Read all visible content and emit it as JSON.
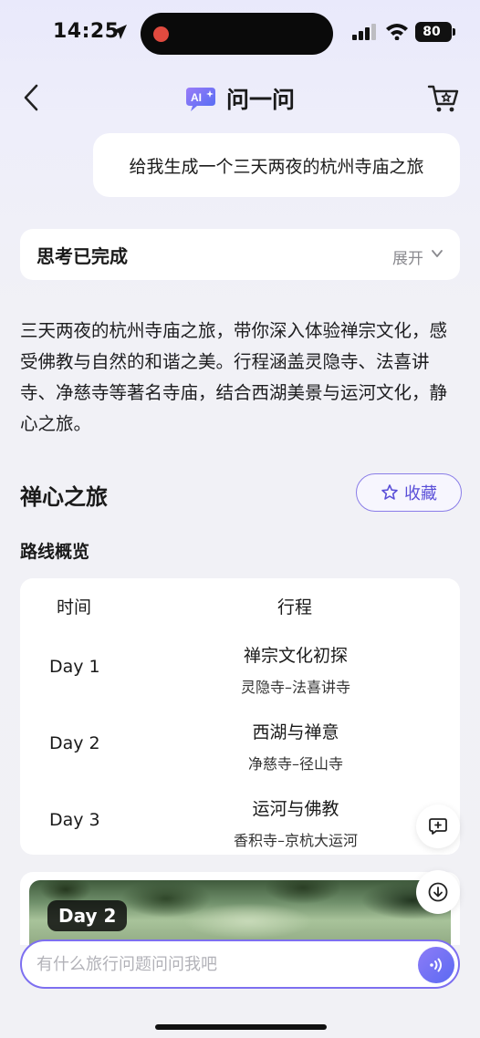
{
  "status_bar": {
    "time": "14:25",
    "battery": "80"
  },
  "nav": {
    "title": "问一问",
    "logo_text": "AI"
  },
  "user_message": "给我生成一个三天两夜的杭州寺庙之旅",
  "thinking": {
    "label": "思考已完成",
    "expand": "展开"
  },
  "intro": "三天两夜的杭州寺庙之旅，带你深入体验禅宗文化，感受佛教与自然的和谐之美。行程涵盖灵隐寺、法喜讲寺、净慈寺等著名寺庙，结合西湖美景与运河文化，静心之旅。",
  "itinerary": {
    "title": "禅心之旅",
    "favorite_label": "收藏",
    "overview_title": "路线概览",
    "columns": [
      "时间",
      "行程"
    ],
    "rows": [
      {
        "day": "Day 1",
        "title": "禅宗文化初探",
        "route": "灵隐寺–法喜讲寺"
      },
      {
        "day": "Day 2",
        "title": "西湖与禅意",
        "route": "净慈寺–径山寺"
      },
      {
        "day": "Day 3",
        "title": "运河与佛教",
        "route": "香积寺–京杭大运河"
      }
    ],
    "image_badge": "Day 2"
  },
  "input": {
    "placeholder": "有什么旅行问题问问我吧",
    "value": ""
  },
  "colors": {
    "accent": "#7d6ff0",
    "accent_text": "#5a4fd8",
    "recording_dot": "#e04a3f"
  }
}
